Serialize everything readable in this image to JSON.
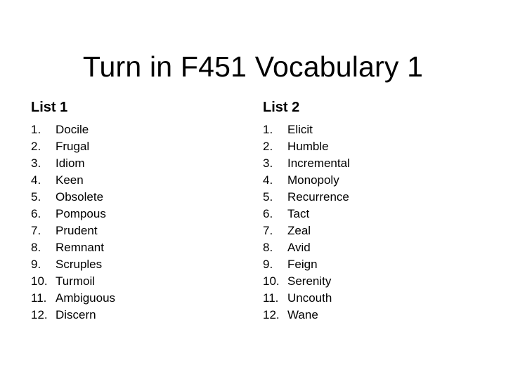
{
  "slide": {
    "title": "Turn in F451 Vocabulary 1"
  },
  "lists": [
    {
      "heading": "List 1",
      "items": [
        {
          "num": "1.",
          "word": "Docile"
        },
        {
          "num": "2.",
          "word": "Frugal"
        },
        {
          "num": "3.",
          "word": "Idiom"
        },
        {
          "num": "4.",
          "word": "Keen"
        },
        {
          "num": "5.",
          "word": "Obsolete"
        },
        {
          "num": "6.",
          "word": "Pompous"
        },
        {
          "num": "7.",
          "word": "Prudent"
        },
        {
          "num": "8.",
          "word": "Remnant"
        },
        {
          "num": "9.",
          "word": "Scruples"
        },
        {
          "num": "10.",
          "word": "Turmoil"
        },
        {
          "num": "11.",
          "word": "Ambiguous"
        },
        {
          "num": "12.",
          "word": "Discern"
        }
      ]
    },
    {
      "heading": "List 2",
      "items": [
        {
          "num": "1.",
          "word": "Elicit"
        },
        {
          "num": "2.",
          "word": "Humble"
        },
        {
          "num": "3.",
          "word": "Incremental"
        },
        {
          "num": "4.",
          "word": "Monopoly"
        },
        {
          "num": "5.",
          "word": "Recurrence"
        },
        {
          "num": "6.",
          "word": "Tact"
        },
        {
          "num": "7.",
          "word": "Zeal"
        },
        {
          "num": "8.",
          "word": "Avid"
        },
        {
          "num": "9.",
          "word": "Feign"
        },
        {
          "num": "10.",
          "word": "Serenity"
        },
        {
          "num": "11.",
          "word": "Uncouth"
        },
        {
          "num": "12.",
          "word": "Wane"
        }
      ]
    }
  ]
}
